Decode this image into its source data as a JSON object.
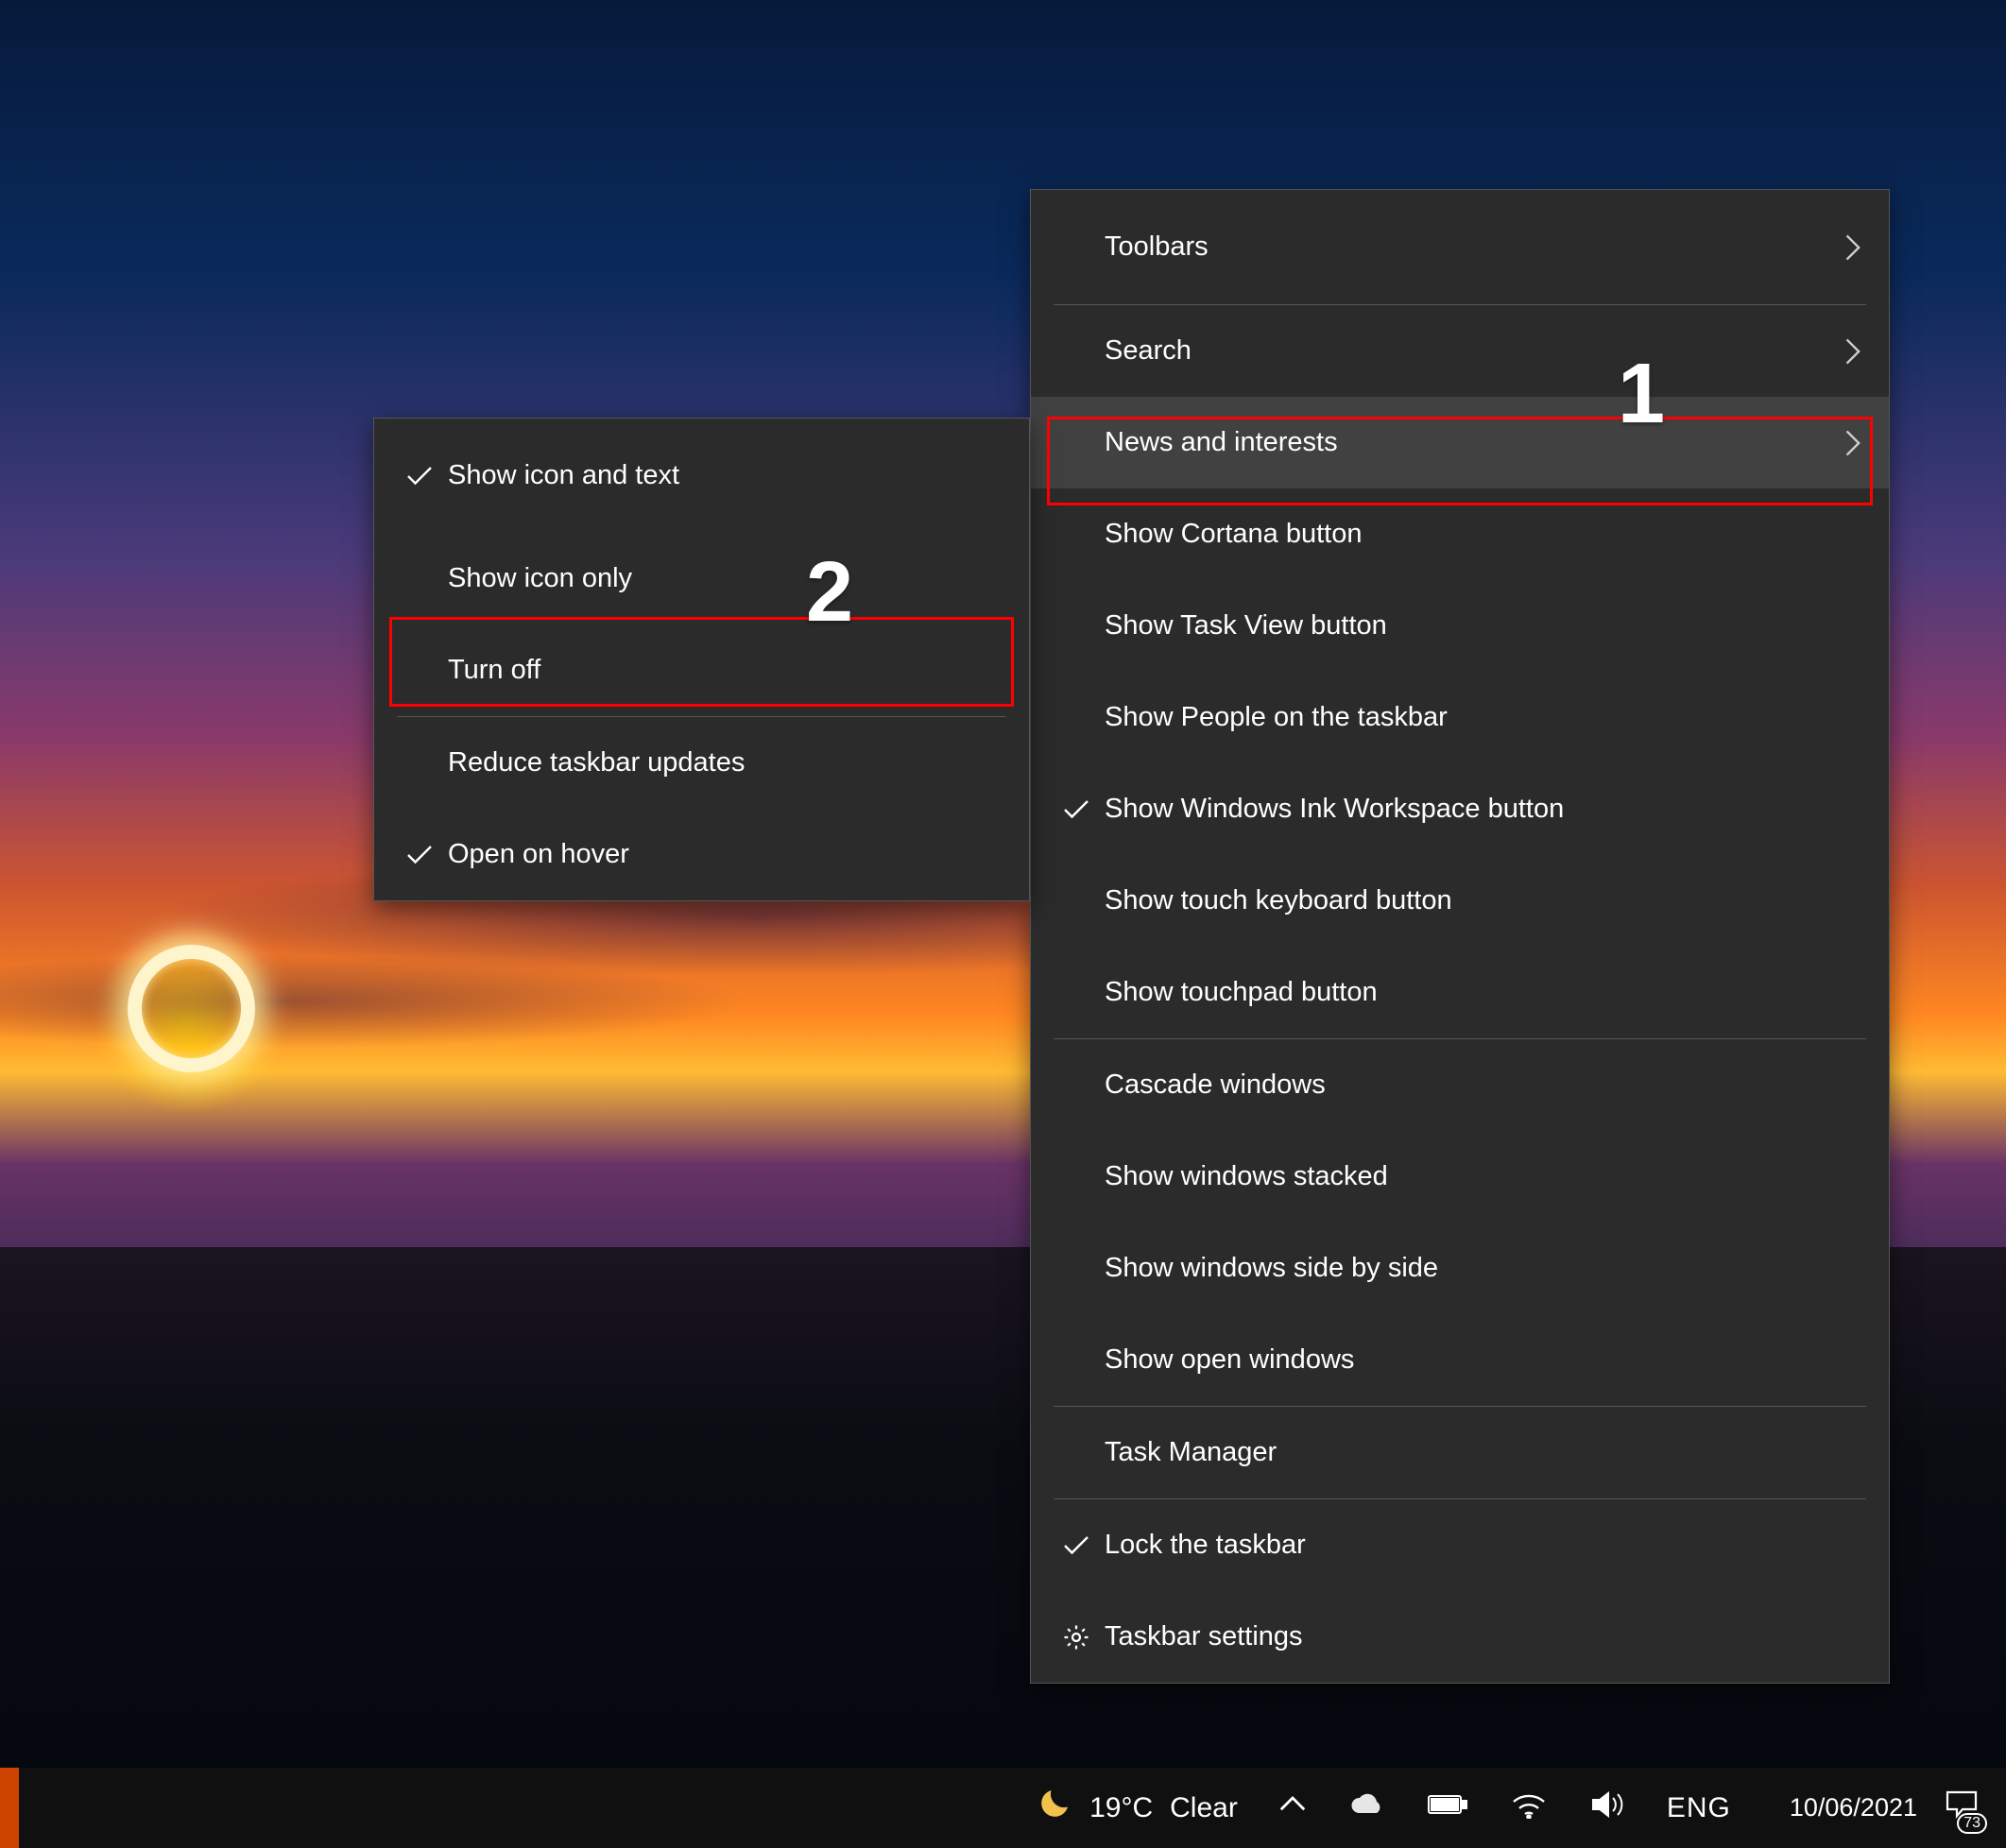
{
  "annotations": {
    "step1": "1",
    "step2": "2"
  },
  "main_menu": {
    "toolbars": "Toolbars",
    "search": "Search",
    "news_interests": "News and interests",
    "cortana": "Show Cortana button",
    "task_view": "Show Task View button",
    "people": "Show People on the taskbar",
    "ink": "Show Windows Ink Workspace button",
    "touch_kb": "Show touch keyboard button",
    "touchpad": "Show touchpad button",
    "cascade": "Cascade windows",
    "stacked": "Show windows stacked",
    "side_by_side": "Show windows side by side",
    "open_windows": "Show open windows",
    "task_manager": "Task Manager",
    "lock": "Lock the taskbar",
    "settings": "Taskbar settings"
  },
  "sub_menu": {
    "icon_text": "Show icon and text",
    "icon_only": "Show icon only",
    "turn_off": "Turn off",
    "reduce": "Reduce taskbar updates",
    "hover": "Open on hover"
  },
  "taskbar": {
    "temperature": "19°C",
    "condition": "Clear",
    "language": "ENG",
    "date": "10/06/2021",
    "notification_count": "73"
  }
}
